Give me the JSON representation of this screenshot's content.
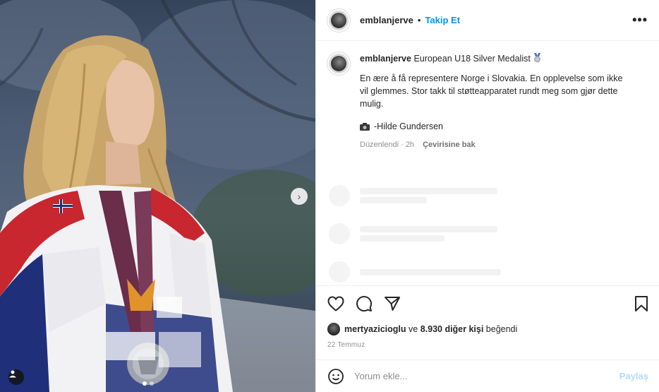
{
  "header": {
    "username": "emblanjerve",
    "separator": "•",
    "follow_label": "Takip Et",
    "more_label": "•••"
  },
  "caption": {
    "username": "emblanjerve",
    "title_text": "European U18 Silver Medalist",
    "body": "En ære å få representere Norge i Slovakia. En opplevelse som ikke vil glemmes. Stor takk til støtteapparatet rundt meg som gjør dette mulig.",
    "credit": "-Hilde Gundersen",
    "edited": "Düzenlendi · 2h",
    "translate_label": "Çevirisine bak"
  },
  "likes": {
    "liker": "mertyazicioglu",
    "middle": " ve ",
    "others": "8.930 diğer kişi",
    "suffix": " beğendi"
  },
  "date": "22 Temmuz",
  "comment": {
    "placeholder": "Yorum ekle...",
    "post_label": "Paylaş"
  },
  "media": {
    "carousel_next_icon": "chevron-right-icon",
    "dots": 2,
    "active_dot": 0
  },
  "colors": {
    "accent": "#0095f6",
    "post_disabled": "#b3dbff",
    "muted": "#8e8e8e"
  }
}
